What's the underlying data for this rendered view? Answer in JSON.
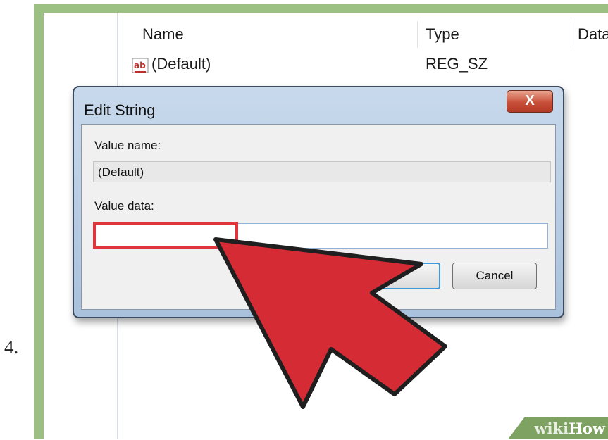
{
  "step": {
    "number": "4."
  },
  "registry": {
    "columns": [
      "Name",
      "Type",
      "Data"
    ],
    "rows": [
      {
        "name": "(Default)",
        "type": "REG_SZ",
        "icon": "string-value-icon"
      }
    ]
  },
  "dialog": {
    "title": "Edit String",
    "close_label": "X",
    "value_name_label": "Value name:",
    "value_name": "(Default)",
    "value_data_label": "Value data:",
    "value_data": "",
    "ok_label": "",
    "cancel_label": "Cancel"
  },
  "watermark": {
    "wiki": "wiki",
    "how": "How"
  },
  "colors": {
    "frame": "#9cc083",
    "highlight": "#e0353d",
    "arrow": "#d52b35"
  }
}
